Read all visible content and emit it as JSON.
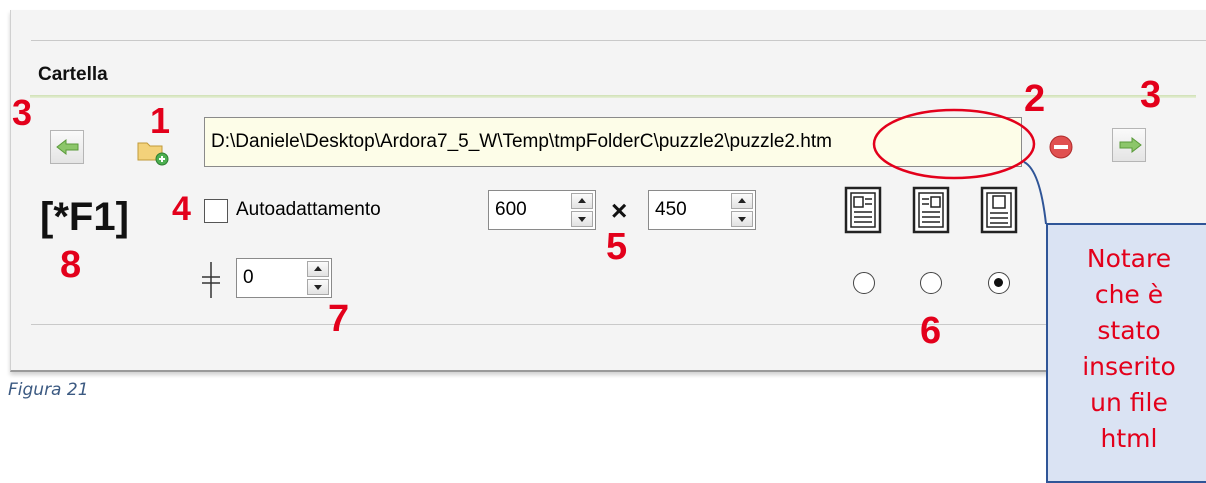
{
  "section": {
    "title": "Cartella"
  },
  "path_field": {
    "value": "D:\\Daniele\\Desktop\\Ardora7_5_W\\Temp\\tmpFolderC\\puzzle2\\puzzle2.htm"
  },
  "buttons": {
    "nav_left_icon": "arrow-left-icon",
    "nav_right_icon": "arrow-right-icon",
    "add_folder_icon": "folder-add-icon",
    "remove_icon": "remove-icon"
  },
  "shortcut": {
    "label": "[*F1]"
  },
  "autoadapt": {
    "label": "Autoadattamento",
    "checked": false
  },
  "size": {
    "width": "600",
    "separator": "×",
    "height": "450"
  },
  "margin": {
    "value": "0"
  },
  "layouts": {
    "options": [
      "layout-left",
      "layout-right",
      "layout-top"
    ],
    "selected_index": 2
  },
  "annotations": {
    "n1": "1",
    "n2": "2",
    "n3_left": "3",
    "n3_right": "3",
    "n4": "4",
    "n5": "5",
    "n6": "6",
    "n7": "7",
    "n8": "8"
  },
  "callout": {
    "lines": [
      "Notare",
      "che è",
      "stato",
      "inserito",
      "un file",
      "html"
    ]
  },
  "caption": "Figura 21",
  "colors": {
    "annotation_red": "#e3001b",
    "callout_fill": "#dae3f3",
    "callout_border": "#2f5597"
  }
}
